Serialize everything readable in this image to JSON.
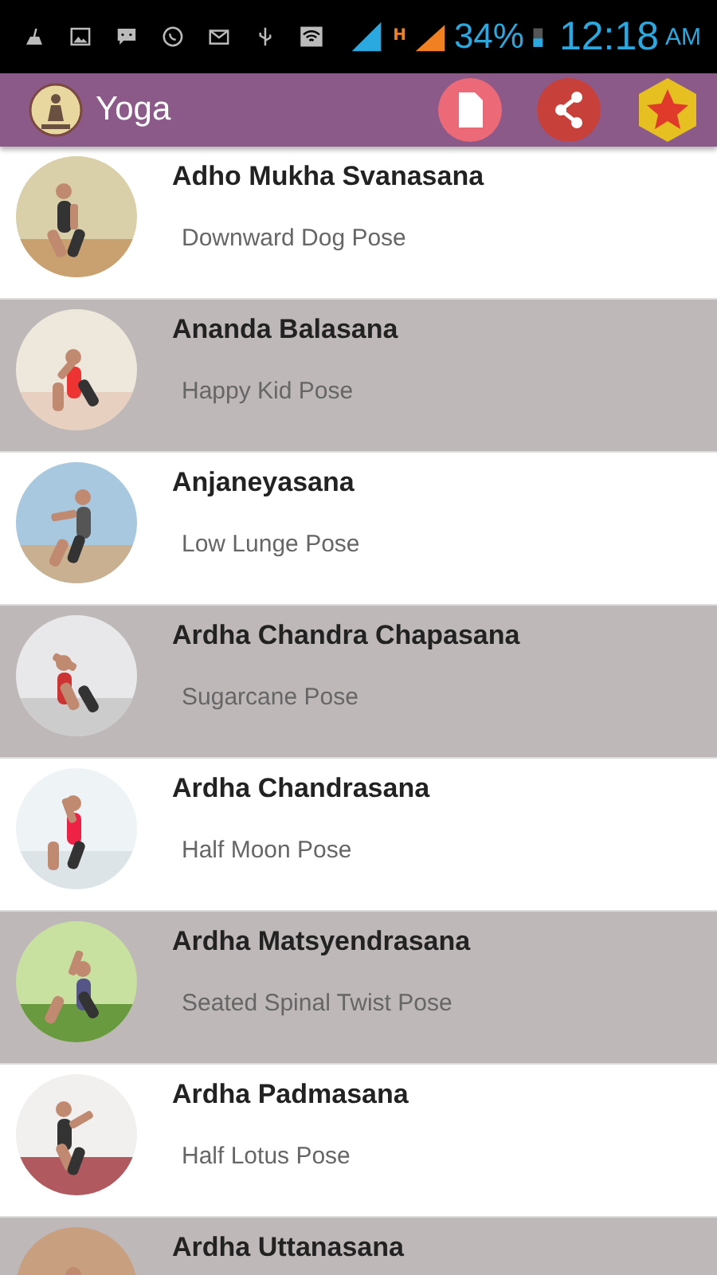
{
  "status_bar": {
    "battery": "34%",
    "network_type": "H",
    "time": "12:18",
    "meridiem": "AM"
  },
  "app_bar": {
    "title": "Yoga"
  },
  "poses": [
    {
      "name": "Adho Mukha Svanasana",
      "english": "Downward Dog Pose"
    },
    {
      "name": "Ananda Balasana",
      "english": "Happy Kid Pose"
    },
    {
      "name": "Anjaneyasana",
      "english": "Low Lunge Pose"
    },
    {
      "name": "Ardha Chandra Chapasana",
      "english": "Sugarcane Pose"
    },
    {
      "name": "Ardha Chandrasana",
      "english": "Half Moon Pose"
    },
    {
      "name": "Ardha Matsyendrasana",
      "english": "Seated Spinal Twist Pose"
    },
    {
      "name": "Ardha Padmasana",
      "english": "Half Lotus Pose"
    },
    {
      "name": "Ardha Uttanasana"
    }
  ]
}
